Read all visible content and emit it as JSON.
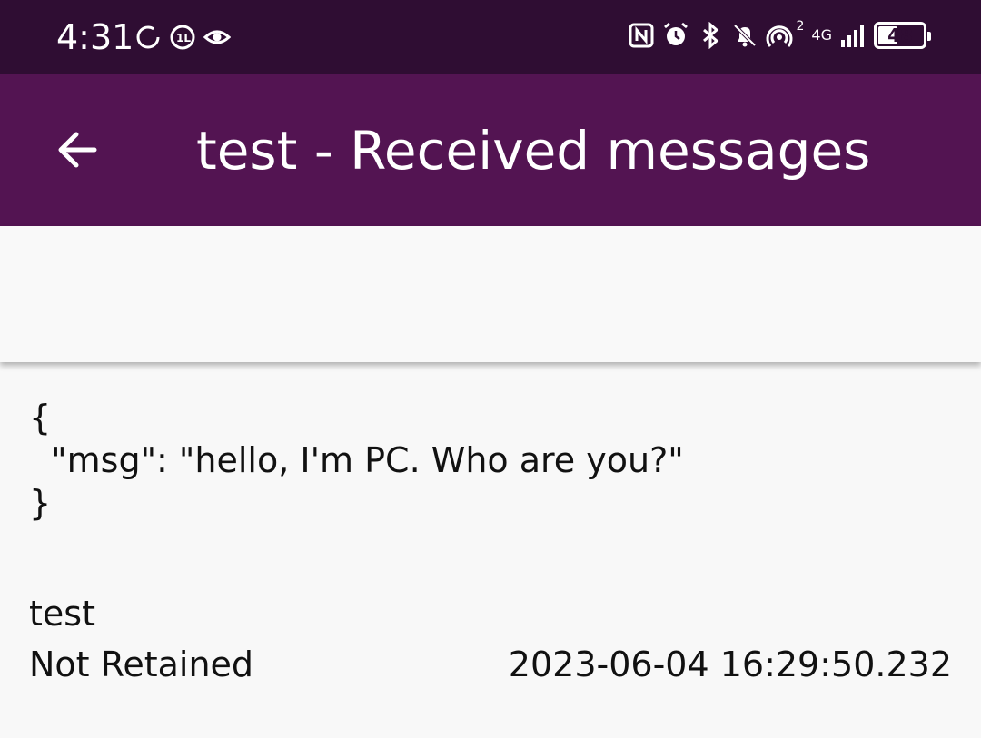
{
  "status_bar": {
    "time": "4:31",
    "left_icons": [
      "sync-icon",
      "data-saver-icon",
      "eye-icon"
    ],
    "right_icons": [
      "nfc-icon",
      "alarm-icon",
      "bluetooth-icon",
      "bell-muted-icon",
      "hotspot-icon",
      "signal-icon"
    ],
    "hotspot_count": "2",
    "network_type": "4G",
    "battery_level": "48",
    "battery_fraction": 0.48
  },
  "app_bar": {
    "title": "test - Received messages",
    "back_icon": "arrow-left-icon",
    "background": "#531452"
  },
  "message": {
    "payload": "{\n  \"msg\": \"hello, I'm PC. Who are you?\"\n}",
    "topic": "test",
    "retained_status": "Not Retained",
    "timestamp": "2023-06-04 16:29:50.232"
  },
  "colors": {
    "status_bar": "#2f0d33",
    "app_bar": "#531452",
    "background": "#f8f8f8",
    "text": "#111111"
  }
}
